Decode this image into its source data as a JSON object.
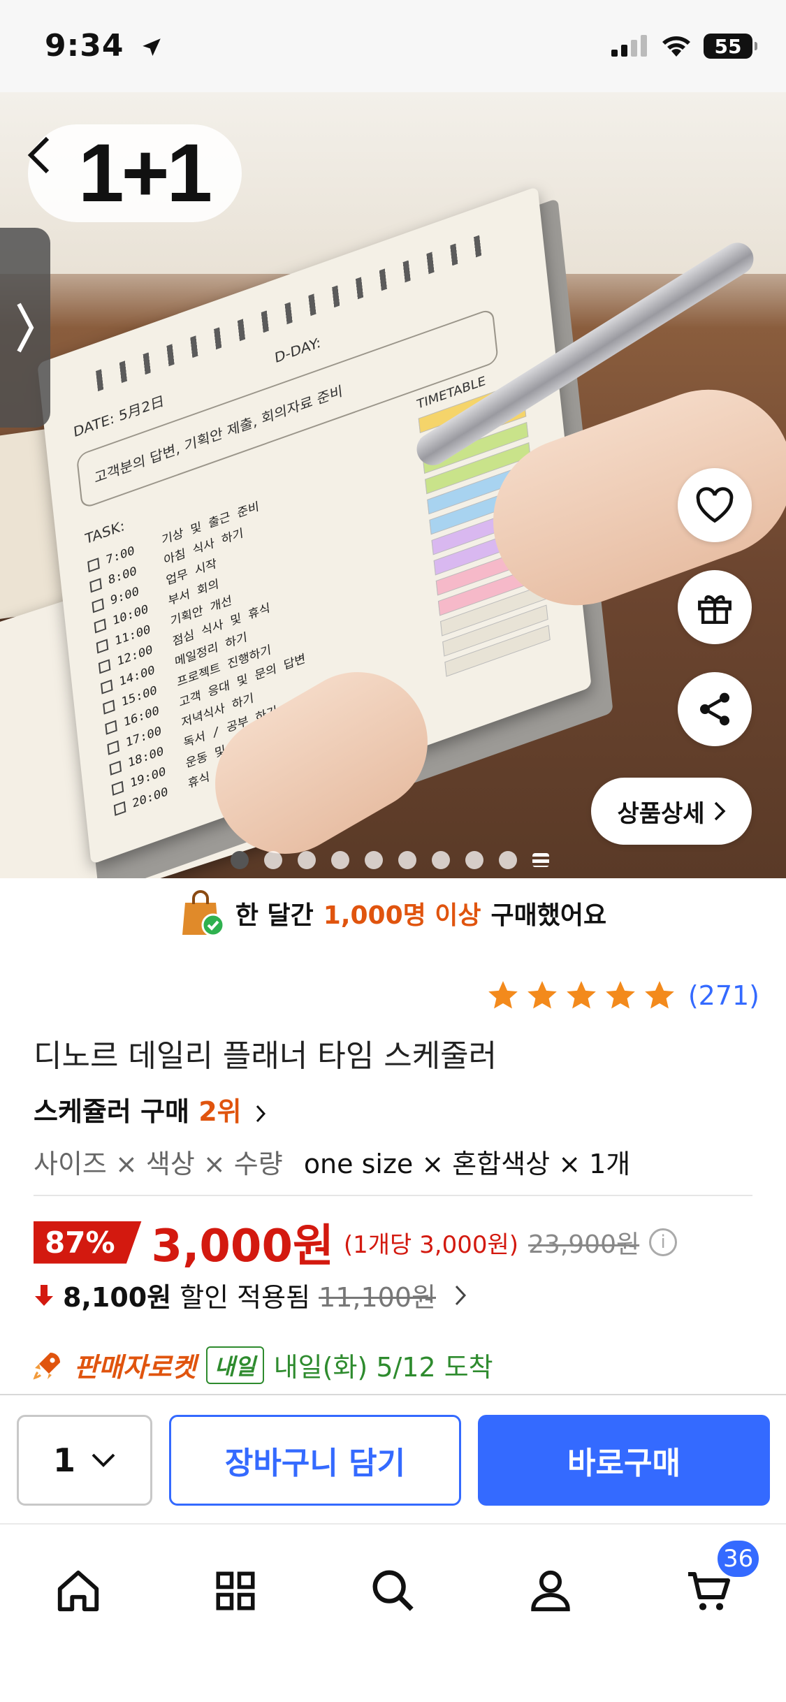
{
  "status_bar": {
    "time": "9:34",
    "battery": "55"
  },
  "hero": {
    "promo_badge": "1+1",
    "page_indicator_count": 10,
    "active_index": 0,
    "detail_button": "상품상세",
    "pad": {
      "date": "DATE: 5月2日",
      "dday": "D-DAY:",
      "memo": "고객분의 답변, 기획안 제출, 회의자료 준비",
      "task_label": "TASK:",
      "timetable_label": "TIMETABLE",
      "tasks": [
        {
          "time": "7:00",
          "text": "기상 및 출근 준비"
        },
        {
          "time": "8:00",
          "text": "아침 식사 하기"
        },
        {
          "time": "9:00",
          "text": "업무 시작"
        },
        {
          "time": "10:00",
          "text": "부서 회의"
        },
        {
          "time": "11:00",
          "text": "기획안 개선"
        },
        {
          "time": "12:00",
          "text": "점심 식사 및 휴식"
        },
        {
          "time": "14:00",
          "text": "메일정리 하기"
        },
        {
          "time": "15:00",
          "text": "프로젝트 진행하기"
        },
        {
          "time": "16:00",
          "text": "고객 응대 및 문의 답변"
        },
        {
          "time": "17:00",
          "text": "저녁식사 하기"
        },
        {
          "time": "18:00",
          "text": "독서 / 공부 하기"
        },
        {
          "time": "19:00",
          "text": "운동 및 씻기"
        },
        {
          "time": "20:00",
          "text": "휴식 및 자기"
        }
      ]
    }
  },
  "purchase_banner": {
    "prefix": "한 달간",
    "highlight": "1,000명 이상",
    "suffix": "구매했어요"
  },
  "rating": {
    "stars": 5,
    "count": "(271)"
  },
  "product": {
    "title": "디노르 데일리 플래너 타임 스케줄러",
    "rank_label": "스케쥴러 구매",
    "rank_value": "2위",
    "option_label": "사이즈 × 색상 × 수량",
    "option_value": "one size × 혼합색상 × 1개"
  },
  "price": {
    "discount_pct": "87%",
    "sale_price": "3,000원",
    "unit_price": "(1개당 3,000원)",
    "original_price": "23,900원",
    "info_icon": "i",
    "extra_discount": "8,100원",
    "extra_label": "할인 적용됨",
    "extra_old": "11,100원"
  },
  "delivery": {
    "label": "판매자로켓",
    "badge": "내일",
    "date": "내일(화) 5/12 도착"
  },
  "action_bar": {
    "quantity": "1",
    "cart_button": "장바구니 담기",
    "buy_button": "바로구매"
  },
  "tab_bar": {
    "cart_badge": "36",
    "tabs": [
      "home-icon",
      "categories-icon",
      "search-icon",
      "profile-icon",
      "cart-icon"
    ]
  },
  "colors": {
    "accent_blue": "#346aff",
    "price_red": "#d3190f",
    "highlight_orange": "#e0540e",
    "delivery_green": "#2e8b2e"
  }
}
